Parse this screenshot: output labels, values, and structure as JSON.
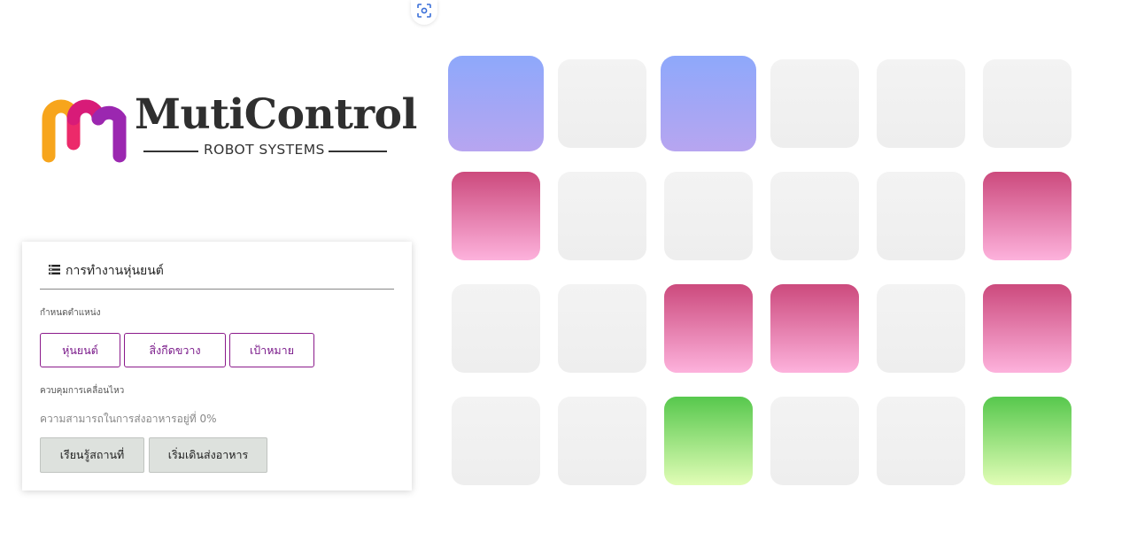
{
  "logo": {
    "brand": "MutiControl",
    "tagline": "ROBOT SYSTEMS",
    "colors": {
      "m_left": "#f7a51c",
      "m_mid": "#e8186d",
      "m_right": "#9b27b0"
    }
  },
  "top_icon": "screenshot-focus-icon",
  "panel": {
    "title": "การทำงานหุ่นยนต์",
    "title_icon": "menu-list-icon",
    "position_label": "กำหนดตำแหน่ง",
    "position_buttons": [
      "หุ่นยนต์",
      "สิ่งกีดขวาง",
      "เป้าหมาย"
    ],
    "movement_label": "ควบคุมการเคลื่อนไหว",
    "status_text": "ความสามารถในการส่งอาหารอยู่ที่ 0%",
    "action_buttons": [
      "เรียนรู้สถานที่",
      "เริ่มเดินส่งอาหาร"
    ]
  },
  "grid": {
    "rows": 4,
    "cols": 6,
    "legend_colors": {
      "robot": "#9fa8f8",
      "obstacle": "#e0689e",
      "target": "#7ad66a",
      "empty": "#f1f1f1"
    },
    "cells": [
      [
        "robot",
        "empty",
        "robot",
        "empty",
        "empty",
        "empty"
      ],
      [
        "obstacle",
        "empty",
        "empty",
        "empty",
        "empty",
        "obstacle"
      ],
      [
        "empty",
        "empty",
        "obstacle",
        "obstacle",
        "empty",
        "obstacle"
      ],
      [
        "empty",
        "empty",
        "target",
        "empty",
        "empty",
        "target"
      ]
    ]
  }
}
